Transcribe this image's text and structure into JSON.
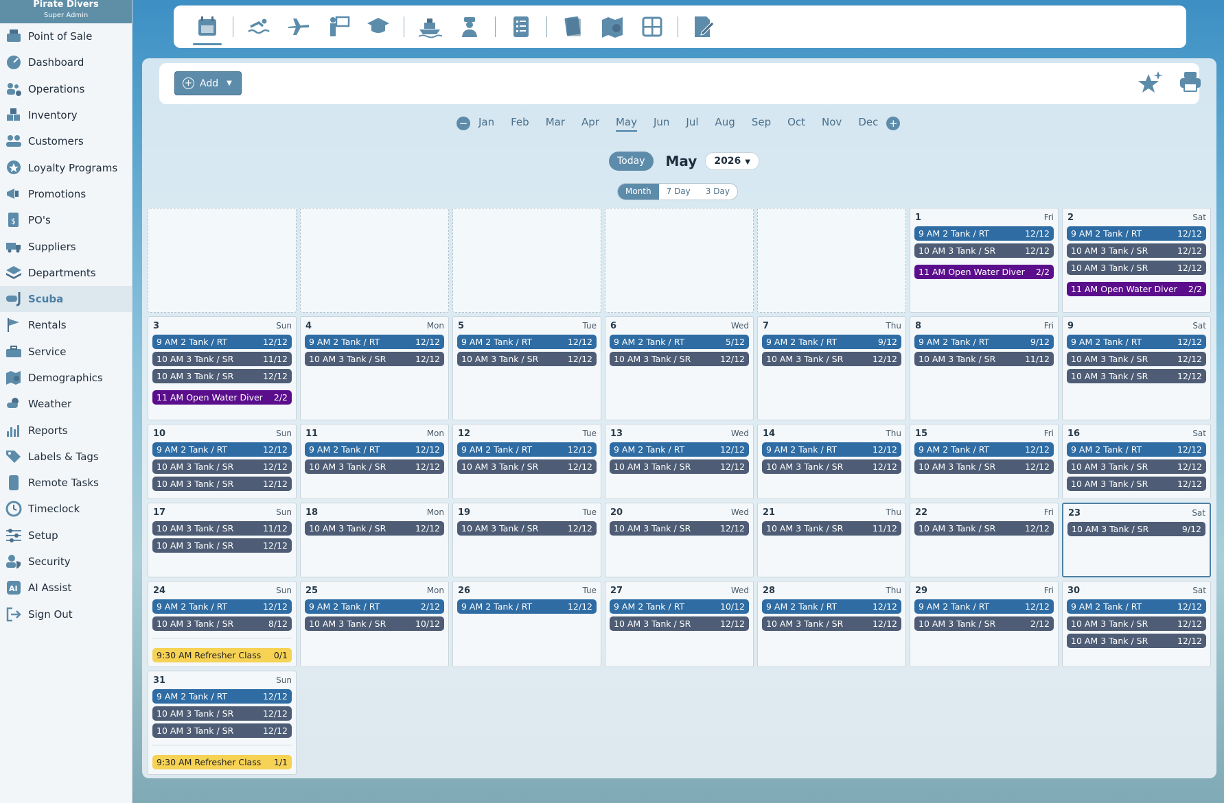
{
  "brand": {
    "name": "Pirate Divers",
    "role": "Super Admin"
  },
  "sidebar": {
    "items": [
      {
        "label": "Point of Sale",
        "icon": "register-icon"
      },
      {
        "label": "Dashboard",
        "icon": "dashboard-icon"
      },
      {
        "label": "Operations",
        "icon": "operations-icon"
      },
      {
        "label": "Inventory",
        "icon": "boxes-icon"
      },
      {
        "label": "Customers",
        "icon": "customers-icon"
      },
      {
        "label": "Loyalty Programs",
        "icon": "loyalty-icon"
      },
      {
        "label": "Promotions",
        "icon": "megaphone-icon"
      },
      {
        "label": "PO's",
        "icon": "purchase-order-icon"
      },
      {
        "label": "Suppliers",
        "icon": "truck-icon"
      },
      {
        "label": "Departments",
        "icon": "layers-icon"
      },
      {
        "label": "Scuba",
        "icon": "snorkel-icon",
        "active": true
      },
      {
        "label": "Rentals",
        "icon": "flag-icon"
      },
      {
        "label": "Service",
        "icon": "toolbox-icon"
      },
      {
        "label": "Demographics",
        "icon": "map-pin-icon"
      },
      {
        "label": "Weather",
        "icon": "weather-icon"
      },
      {
        "label": "Reports",
        "icon": "bar-chart-icon"
      },
      {
        "label": "Labels & Tags",
        "icon": "tags-icon"
      },
      {
        "label": "Remote Tasks",
        "icon": "tablet-icon"
      },
      {
        "label": "Timeclock",
        "icon": "clock-icon"
      },
      {
        "label": "Setup",
        "icon": "sliders-icon"
      },
      {
        "label": "Security",
        "icon": "user-shield-icon"
      },
      {
        "label": "AI Assist",
        "icon": "ai-icon"
      },
      {
        "label": "Sign Out",
        "icon": "sign-out-icon"
      }
    ]
  },
  "toolbar": {
    "groups": [
      [
        "calendar-icon"
      ],
      [
        "swimmer-icon",
        "plane-icon",
        "instructor-icon",
        "graduation-cap-icon"
      ],
      [
        "boat-icon",
        "captain-icon"
      ],
      [
        "checklist-icon"
      ],
      [
        "book-icon",
        "map-icon",
        "grid-icon"
      ],
      [
        "edit-document-icon"
      ]
    ]
  },
  "actions": {
    "add_label": "Add"
  },
  "months": [
    "Jan",
    "Feb",
    "Mar",
    "Apr",
    "May",
    "Jun",
    "Jul",
    "Aug",
    "Sep",
    "Oct",
    "Nov",
    "Dec"
  ],
  "selected_month_index": 4,
  "nav": {
    "today_label": "Today",
    "month_title": "May",
    "year": "2026"
  },
  "views": [
    "Month",
    "7 Day",
    "3 Day"
  ],
  "selected_view": "Month",
  "calendar": {
    "weeks": [
      [
        {
          "empty": true
        },
        {
          "empty": true
        },
        {
          "empty": true
        },
        {
          "empty": true
        },
        {
          "empty": true
        },
        {
          "day": "1",
          "dow": "Fri",
          "events": [
            {
              "name": "9 AM 2 Tank / RT",
              "count": "12/12",
              "type": "rt"
            },
            {
              "name": "10 AM 3 Tank / SR",
              "count": "12/12",
              "type": "sr"
            },
            {
              "name": "11 AM Open Water Diver",
              "count": "2/2",
              "type": "owd"
            }
          ]
        },
        {
          "day": "2",
          "dow": "Sat",
          "events": [
            {
              "name": "9 AM 2 Tank / RT",
              "count": "12/12",
              "type": "rt"
            },
            {
              "name": "10 AM 3 Tank / SR",
              "count": "12/12",
              "type": "sr"
            },
            {
              "name": "10 AM 3 Tank / SR",
              "count": "12/12",
              "type": "sr"
            },
            {
              "name": "11 AM Open Water Diver",
              "count": "2/2",
              "type": "owd"
            }
          ]
        }
      ],
      [
        {
          "day": "3",
          "dow": "Sun",
          "events": [
            {
              "name": "9 AM 2 Tank / RT",
              "count": "12/12",
              "type": "rt"
            },
            {
              "name": "10 AM 3 Tank / SR",
              "count": "11/12",
              "type": "sr"
            },
            {
              "name": "10 AM 3 Tank / SR",
              "count": "12/12",
              "type": "sr"
            },
            {
              "name": "11 AM Open Water Diver",
              "count": "2/2",
              "type": "owd"
            }
          ]
        },
        {
          "day": "4",
          "dow": "Mon",
          "events": [
            {
              "name": "9 AM 2 Tank / RT",
              "count": "12/12",
              "type": "rt"
            },
            {
              "name": "10 AM 3 Tank / SR",
              "count": "12/12",
              "type": "sr"
            }
          ]
        },
        {
          "day": "5",
          "dow": "Tue",
          "events": [
            {
              "name": "9 AM 2 Tank / RT",
              "count": "12/12",
              "type": "rt"
            },
            {
              "name": "10 AM 3 Tank / SR",
              "count": "12/12",
              "type": "sr"
            }
          ]
        },
        {
          "day": "6",
          "dow": "Wed",
          "events": [
            {
              "name": "9 AM 2 Tank / RT",
              "count": "5/12",
              "type": "rt"
            },
            {
              "name": "10 AM 3 Tank / SR",
              "count": "12/12",
              "type": "sr"
            }
          ]
        },
        {
          "day": "7",
          "dow": "Thu",
          "events": [
            {
              "name": "9 AM 2 Tank / RT",
              "count": "9/12",
              "type": "rt"
            },
            {
              "name": "10 AM 3 Tank / SR",
              "count": "12/12",
              "type": "sr"
            }
          ]
        },
        {
          "day": "8",
          "dow": "Fri",
          "events": [
            {
              "name": "9 AM 2 Tank / RT",
              "count": "9/12",
              "type": "rt"
            },
            {
              "name": "10 AM 3 Tank / SR",
              "count": "11/12",
              "type": "sr"
            }
          ]
        },
        {
          "day": "9",
          "dow": "Sat",
          "events": [
            {
              "name": "9 AM 2 Tank / RT",
              "count": "12/12",
              "type": "rt"
            },
            {
              "name": "10 AM 3 Tank / SR",
              "count": "12/12",
              "type": "sr"
            },
            {
              "name": "10 AM 3 Tank / SR",
              "count": "12/12",
              "type": "sr"
            }
          ]
        }
      ],
      [
        {
          "day": "10",
          "dow": "Sun",
          "events": [
            {
              "name": "9 AM 2 Tank / RT",
              "count": "12/12",
              "type": "rt"
            },
            {
              "name": "10 AM 3 Tank / SR",
              "count": "12/12",
              "type": "sr"
            },
            {
              "name": "10 AM 3 Tank / SR",
              "count": "12/12",
              "type": "sr"
            }
          ]
        },
        {
          "day": "11",
          "dow": "Mon",
          "events": [
            {
              "name": "9 AM 2 Tank / RT",
              "count": "12/12",
              "type": "rt"
            },
            {
              "name": "10 AM 3 Tank / SR",
              "count": "12/12",
              "type": "sr"
            }
          ]
        },
        {
          "day": "12",
          "dow": "Tue",
          "events": [
            {
              "name": "9 AM 2 Tank / RT",
              "count": "12/12",
              "type": "rt"
            },
            {
              "name": "10 AM 3 Tank / SR",
              "count": "12/12",
              "type": "sr"
            }
          ]
        },
        {
          "day": "13",
          "dow": "Wed",
          "events": [
            {
              "name": "9 AM 2 Tank / RT",
              "count": "12/12",
              "type": "rt"
            },
            {
              "name": "10 AM 3 Tank / SR",
              "count": "12/12",
              "type": "sr"
            }
          ]
        },
        {
          "day": "14",
          "dow": "Thu",
          "events": [
            {
              "name": "9 AM 2 Tank / RT",
              "count": "12/12",
              "type": "rt"
            },
            {
              "name": "10 AM 3 Tank / SR",
              "count": "12/12",
              "type": "sr"
            }
          ]
        },
        {
          "day": "15",
          "dow": "Fri",
          "events": [
            {
              "name": "9 AM 2 Tank / RT",
              "count": "12/12",
              "type": "rt"
            },
            {
              "name": "10 AM 3 Tank / SR",
              "count": "12/12",
              "type": "sr"
            }
          ]
        },
        {
          "day": "16",
          "dow": "Sat",
          "events": [
            {
              "name": "9 AM 2 Tank / RT",
              "count": "12/12",
              "type": "rt"
            },
            {
              "name": "10 AM 3 Tank / SR",
              "count": "12/12",
              "type": "sr"
            },
            {
              "name": "10 AM 3 Tank / SR",
              "count": "12/12",
              "type": "sr"
            }
          ]
        }
      ],
      [
        {
          "day": "17",
          "dow": "Sun",
          "events": [
            {
              "name": "10 AM 3 Tank / SR",
              "count": "11/12",
              "type": "sr"
            },
            {
              "name": "10 AM 3 Tank / SR",
              "count": "12/12",
              "type": "sr"
            }
          ]
        },
        {
          "day": "18",
          "dow": "Mon",
          "events": [
            {
              "name": "10 AM 3 Tank / SR",
              "count": "12/12",
              "type": "sr"
            }
          ]
        },
        {
          "day": "19",
          "dow": "Tue",
          "events": [
            {
              "name": "10 AM 3 Tank / SR",
              "count": "12/12",
              "type": "sr"
            }
          ]
        },
        {
          "day": "20",
          "dow": "Wed",
          "events": [
            {
              "name": "10 AM 3 Tank / SR",
              "count": "12/12",
              "type": "sr"
            }
          ]
        },
        {
          "day": "21",
          "dow": "Thu",
          "events": [
            {
              "name": "10 AM 3 Tank / SR",
              "count": "11/12",
              "type": "sr"
            }
          ]
        },
        {
          "day": "22",
          "dow": "Fri",
          "events": [
            {
              "name": "10 AM 3 Tank / SR",
              "count": "12/12",
              "type": "sr"
            }
          ]
        },
        {
          "day": "23",
          "dow": "Sat",
          "selected": true,
          "events": [
            {
              "name": "10 AM 3 Tank / SR",
              "count": "9/12",
              "type": "sr"
            }
          ]
        }
      ],
      [
        {
          "day": "24",
          "dow": "Sun",
          "events": [
            {
              "name": "9 AM 2 Tank / RT",
              "count": "12/12",
              "type": "rt"
            },
            {
              "name": "10 AM 3 Tank / SR",
              "count": "8/12",
              "type": "sr"
            },
            {
              "name": "9:30 AM Refresher Class",
              "count": "0/1",
              "type": "ref"
            }
          ]
        },
        {
          "day": "25",
          "dow": "Mon",
          "events": [
            {
              "name": "9 AM 2 Tank / RT",
              "count": "2/12",
              "type": "rt"
            },
            {
              "name": "10 AM 3 Tank / SR",
              "count": "10/12",
              "type": "sr"
            }
          ]
        },
        {
          "day": "26",
          "dow": "Tue",
          "events": [
            {
              "name": "9 AM 2 Tank / RT",
              "count": "12/12",
              "type": "rt"
            }
          ]
        },
        {
          "day": "27",
          "dow": "Wed",
          "events": [
            {
              "name": "9 AM 2 Tank / RT",
              "count": "10/12",
              "type": "rt"
            },
            {
              "name": "10 AM 3 Tank / SR",
              "count": "12/12",
              "type": "sr"
            }
          ]
        },
        {
          "day": "28",
          "dow": "Thu",
          "events": [
            {
              "name": "9 AM 2 Tank / RT",
              "count": "12/12",
              "type": "rt"
            },
            {
              "name": "10 AM 3 Tank / SR",
              "count": "12/12",
              "type": "sr"
            }
          ]
        },
        {
          "day": "29",
          "dow": "Fri",
          "events": [
            {
              "name": "9 AM 2 Tank / RT",
              "count": "12/12",
              "type": "rt"
            },
            {
              "name": "10 AM 3 Tank / SR",
              "count": "2/12",
              "type": "sr"
            }
          ]
        },
        {
          "day": "30",
          "dow": "Sat",
          "events": [
            {
              "name": "9 AM 2 Tank / RT",
              "count": "12/12",
              "type": "rt"
            },
            {
              "name": "10 AM 3 Tank / SR",
              "count": "12/12",
              "type": "sr"
            },
            {
              "name": "10 AM 3 Tank / SR",
              "count": "12/12",
              "type": "sr"
            }
          ]
        }
      ],
      [
        {
          "day": "31",
          "dow": "Sun",
          "events": [
            {
              "name": "9 AM 2 Tank / RT",
              "count": "12/12",
              "type": "rt"
            },
            {
              "name": "10 AM 3 Tank / SR",
              "count": "12/12",
              "type": "sr"
            },
            {
              "name": "10 AM 3 Tank / SR",
              "count": "12/12",
              "type": "sr"
            },
            {
              "name": "9:30 AM Refresher Class",
              "count": "1/1",
              "type": "ref"
            }
          ]
        }
      ]
    ]
  }
}
